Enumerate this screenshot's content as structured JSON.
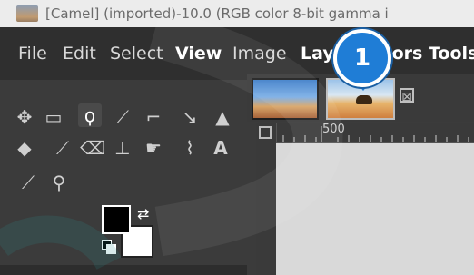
{
  "window": {
    "title": "[Camel] (imported)-10.0 (RGB color 8-bit gamma i"
  },
  "menu": {
    "items": [
      "File",
      "Edit",
      "Select",
      "View",
      "Image",
      "Laye",
      "olors",
      "Tools"
    ]
  },
  "callout": {
    "number": "1"
  },
  "tabs": [
    {
      "name": "image-tab-1",
      "icon": "landscape-thumbnail"
    },
    {
      "name": "image-tab-2",
      "icon": "camel-thumbnail"
    }
  ],
  "tab_close": "⊠",
  "ruler": {
    "label": "500"
  },
  "tools": [
    {
      "name": "move-tool-icon",
      "glyph": "✥"
    },
    {
      "name": "rect-select-tool-icon",
      "glyph": "▭"
    },
    {
      "name": "free-select-tool-icon",
      "glyph": "ϙ"
    },
    {
      "name": "fuzzy-select-tool-icon",
      "glyph": "⟋"
    },
    {
      "name": "crop-tool-icon",
      "glyph": "⌐"
    },
    {
      "name": "unified-transform-tool-icon",
      "glyph": "↘"
    },
    {
      "name": "warp-transform-tool-icon",
      "glyph": "▲"
    },
    {
      "name": "bucket-fill-tool-icon",
      "glyph": "◆"
    },
    {
      "name": "paintbrush-tool-icon",
      "glyph": "⟋"
    },
    {
      "name": "eraser-tool-icon",
      "glyph": "⌫"
    },
    {
      "name": "clone-tool-icon",
      "glyph": "⊥"
    },
    {
      "name": "smudge-tool-icon",
      "glyph": "☛"
    },
    {
      "name": "paths-tool-icon",
      "glyph": "⌇"
    },
    {
      "name": "text-tool-icon",
      "glyph": "A"
    },
    {
      "name": "color-picker-tool-icon",
      "glyph": "⟋"
    },
    {
      "name": "zoom-tool-icon",
      "glyph": "⚲"
    }
  ],
  "colors": {
    "foreground": "#000000",
    "background": "#ffffff",
    "accent": "#1f7dd6"
  }
}
